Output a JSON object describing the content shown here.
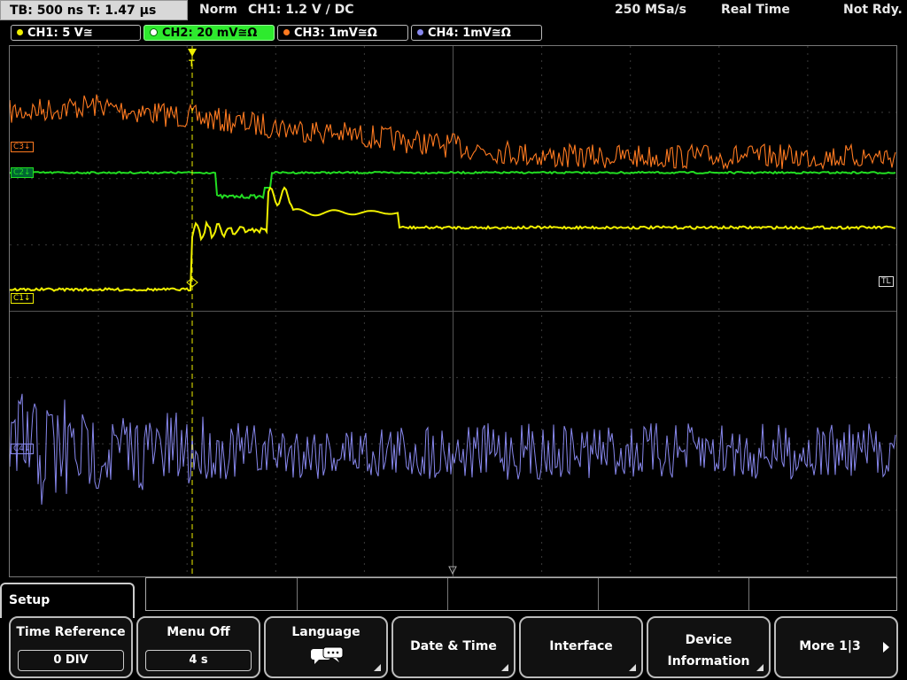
{
  "topbar": {
    "timebase": "TB: 500 ns   T: 1.47 µs",
    "mode": "Norm",
    "trigger": "CH1: 1.2 V  ∕ DC",
    "sample_rate": "250 MSa/s",
    "acq_mode": "Real Time",
    "state": "Not Rdy."
  },
  "channels": [
    {
      "label": "CH1: 5 V≅",
      "color": "#f0f000"
    },
    {
      "label": "CH2: 20 mV≅Ω",
      "color": "#22dd22"
    },
    {
      "label": "CH3: 1mV≅Ω",
      "color": "#ff7a20"
    },
    {
      "label": "CH4: 1mV≅Ω",
      "color": "#8888ee"
    }
  ],
  "markers": {
    "c3": "C3↓",
    "c2": "C2↓",
    "c1": "C1↓",
    "c4": "C4↓",
    "tl": "TL",
    "trigger": "T"
  },
  "menu": {
    "title": "Setup",
    "softkeys": [
      {
        "label": "Time Reference",
        "value": "0 DIV"
      },
      {
        "label": "Menu Off",
        "value": "4 s"
      },
      {
        "label": "Language",
        "icon": "speech-bubble-icon"
      },
      {
        "label": "Date & Time"
      },
      {
        "label": "Interface"
      },
      {
        "label": "Device Information"
      },
      {
        "label": "More 1|3"
      }
    ]
  },
  "colors": {
    "ch1": "#f0f000",
    "ch2": "#22dd22",
    "ch3": "#ff7a20",
    "ch4": "#8888ee",
    "grid": "#444444"
  }
}
